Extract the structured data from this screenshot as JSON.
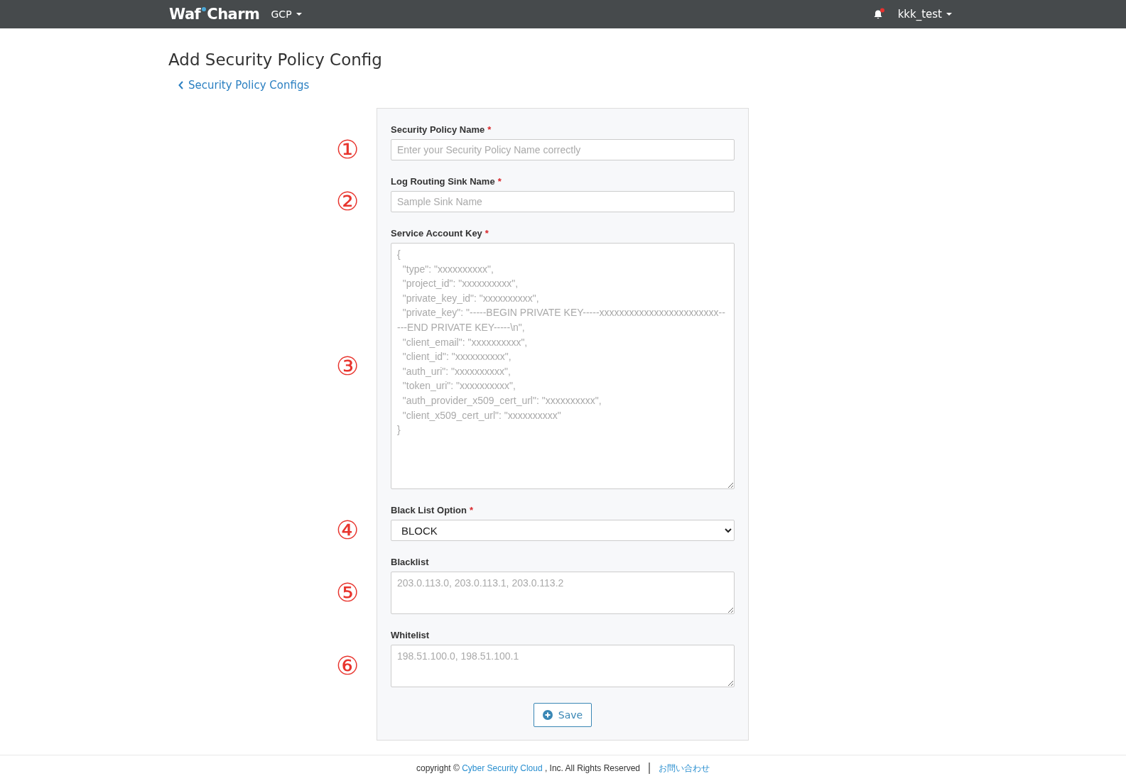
{
  "navbar": {
    "logo": "Waf Charm",
    "platform_menu": "GCP",
    "user_menu": "kkk_test",
    "has_notification": true
  },
  "page": {
    "title": "Add Security Policy Config",
    "back_link": "Security Policy Configs"
  },
  "form": {
    "fields": [
      {
        "marker": "①",
        "label": "Security Policy Name",
        "required_mark": "*",
        "kind": "text",
        "placeholder": "Enter your Security Policy Name correctly"
      },
      {
        "marker": "②",
        "label": "Log Routing Sink Name",
        "required_mark": "*",
        "kind": "text",
        "placeholder": "Sample Sink Name"
      },
      {
        "marker": "③",
        "label": "Service Account Key",
        "required_mark": "*",
        "kind": "keyarea",
        "placeholder": "{\n  \"type\": \"xxxxxxxxxx\",\n  \"project_id\": \"xxxxxxxxxx\",\n  \"private_key_id\": \"xxxxxxxxxx\",\n  \"private_key\": \"-----BEGIN PRIVATE KEY-----xxxxxxxxxxxxxxxxxxxxxxxx-----END PRIVATE KEY-----\\n\",\n  \"client_email\": \"xxxxxxxxxx\",\n  \"client_id\": \"xxxxxxxxxx\",\n  \"auth_uri\": \"xxxxxxxxxx\",\n  \"token_uri\": \"xxxxxxxxxx\",\n  \"auth_provider_x509_cert_url\": \"xxxxxxxxxx\",\n  \"client_x509_cert_url\": \"xxxxxxxxxx\"\n}"
      },
      {
        "marker": "④",
        "label": "Black List Option",
        "required_mark": "*",
        "kind": "select",
        "value": "BLOCK"
      },
      {
        "marker": "⑤",
        "label": "Blacklist",
        "kind": "textarea",
        "placeholder": "203.0.113.0, 203.0.113.1, 203.0.113.2"
      },
      {
        "marker": "⑥",
        "label": "Whitelist",
        "kind": "textarea",
        "placeholder": "198.51.100.0, 198.51.100.1"
      }
    ],
    "save_button": "Save"
  },
  "footer": {
    "copyright_prefix": "copyright ©",
    "company_link": "Cyber Security Cloud",
    "copyright_suffix": ", Inc. All Rights Reserved",
    "contact_link": "お問い合わせ"
  }
}
